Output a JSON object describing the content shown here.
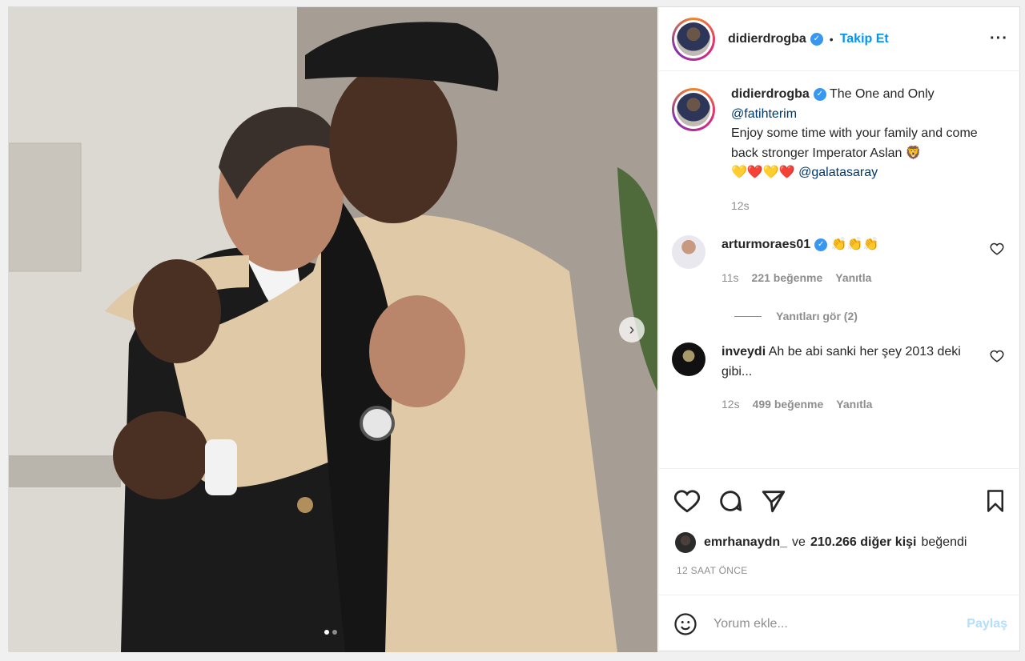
{
  "post": {
    "username": "didierdrogba",
    "follow_label": "Takip Et",
    "more_icon": "more-icon"
  },
  "caption": {
    "username": "didierdrogba",
    "line1": "The One and Only",
    "mention1": "@fatihterim",
    "text": "Enjoy some time with your family and come back stronger Imperator Aslan 🦁",
    "emojis": "💛❤️💛❤️",
    "mention2": "@galatasaray",
    "time": "12s"
  },
  "comments": [
    {
      "username": "arturmoraes01",
      "text": "👏👏👏",
      "time": "11s",
      "likes": "221 beğenme",
      "reply": "Yanıtla"
    },
    {
      "username": "inveydi",
      "text": "Ah be abi sanki her şey 2013 deki gibi...",
      "time": "12s",
      "likes": "499 beğenme",
      "reply": "Yanıtla"
    }
  ],
  "view_replies": "Yanıtları gör (2)",
  "likes": {
    "user": "emrhanaydn_",
    "connector": "ve",
    "count": "210.266 diğer kişi",
    "suffix": "beğendi"
  },
  "time_ago": "12 SAAT ÖNCE",
  "comment_input": {
    "placeholder": "Yorum ekle...",
    "share": "Paylaş"
  },
  "colors": {
    "accent": "#0095f6",
    "verified": "#3897f0",
    "muted": "#8e8e8e"
  },
  "carousel": {
    "count": 2,
    "active": 1
  }
}
